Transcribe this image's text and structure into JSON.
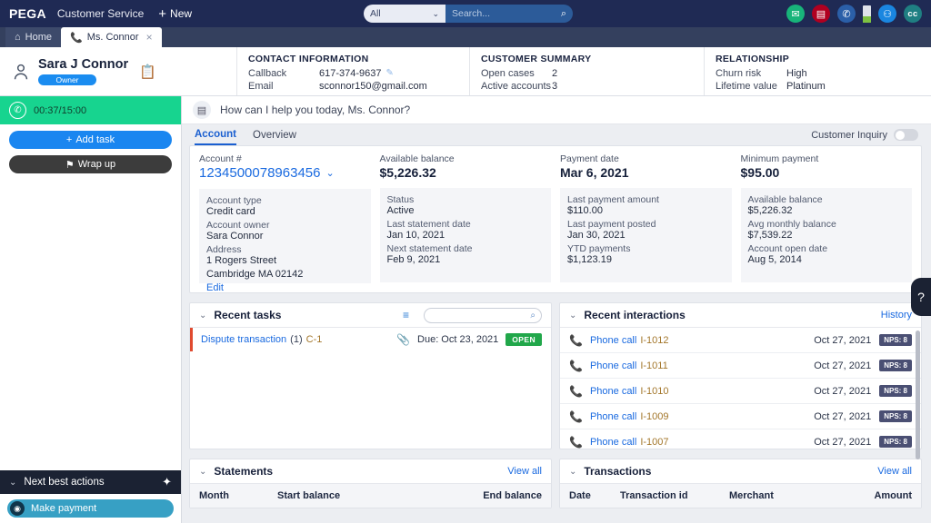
{
  "topbar": {
    "brand": "PEGA",
    "app_name": "Customer Service",
    "new_label": "New",
    "search": {
      "scope": "All",
      "placeholder": "Search...",
      "value": ""
    },
    "icons": [
      "envelope-icon",
      "chat-icon",
      "phone-icon",
      "status-bar-icon",
      "bot-icon",
      "avatar-cc"
    ],
    "avatar_initials": "cc"
  },
  "tabs": [
    {
      "label": "Home",
      "icon": "home-icon",
      "active": false
    },
    {
      "label": "Ms. Connor",
      "icon": "phone-icon",
      "active": true,
      "closable": true
    }
  ],
  "customer_header": {
    "name": "Sara J Connor",
    "role_badge": "Owner",
    "contact": {
      "title": "CONTACT INFORMATION",
      "rows": [
        {
          "key": "Callback",
          "value": "617-374-9637",
          "editable": true
        },
        {
          "key": "Email",
          "value": "sconnor150@gmail.com",
          "editable": false
        }
      ]
    },
    "summary": {
      "title": "CUSTOMER SUMMARY",
      "rows": [
        {
          "key": "Open cases",
          "value": "2"
        },
        {
          "key": "Active accounts",
          "value": "3"
        }
      ]
    },
    "relationship": {
      "title": "RELATIONSHIP",
      "rows": [
        {
          "key": "Churn risk",
          "value": "High"
        },
        {
          "key": "Lifetime value",
          "value": "Platinum"
        }
      ]
    }
  },
  "rail": {
    "timer": "00:37/15:00",
    "add_task": "Add task",
    "wrap_up": "Wrap up",
    "nba_title": "Next best actions",
    "nba_items": [
      {
        "label": "Make payment"
      }
    ]
  },
  "main": {
    "prompt": "How can I help you today, Ms. Connor?",
    "tabs": [
      {
        "label": "Account",
        "active": true
      },
      {
        "label": "Overview",
        "active": false
      }
    ],
    "inquiry_label": "Customer Inquiry",
    "inquiry_on": false
  },
  "account": {
    "columns": [
      {
        "label": "Account #",
        "value": "1234500078963456",
        "is_link": true,
        "details": [
          {
            "k": "Account type",
            "v": "Credit card"
          },
          {
            "k": "Account owner",
            "v": "Sara Connor"
          },
          {
            "k": "Address",
            "v": "1 Rogers Street"
          },
          {
            "k": "",
            "v": "Cambridge  MA 02142"
          }
        ],
        "edit_link": "Edit"
      },
      {
        "label": "Available balance",
        "value": "$5,226.32",
        "is_link": false,
        "details": [
          {
            "k": "Status",
            "v": "Active"
          },
          {
            "k": "Last statement date",
            "v": "Jan 10, 2021"
          },
          {
            "k": "Next statement date",
            "v": "Feb 9, 2021"
          }
        ]
      },
      {
        "label": "Payment date",
        "value": "Mar 6, 2021",
        "is_link": false,
        "details": [
          {
            "k": "Last payment amount",
            "v": "$110.00"
          },
          {
            "k": "Last payment posted",
            "v": "Jan 30, 2021"
          },
          {
            "k": "YTD payments",
            "v": "$1,123.19"
          }
        ]
      },
      {
        "label": "Minimum payment",
        "value": "$95.00",
        "is_link": false,
        "details": [
          {
            "k": "Available balance",
            "v": "$5,226.32"
          },
          {
            "k": "Avg monthly balance",
            "v": "$7,539.22"
          },
          {
            "k": "Account open date",
            "v": "Aug 5, 2014"
          }
        ]
      }
    ]
  },
  "recent_tasks": {
    "title": "Recent tasks",
    "search_placeholder": "",
    "rows": [
      {
        "name": "Dispute transaction",
        "count": "(1)",
        "id": "C-1",
        "due": "Due: Oct 23, 2021",
        "status": "OPEN"
      }
    ]
  },
  "recent_interactions": {
    "title": "Recent interactions",
    "history_link": "History",
    "rows": [
      {
        "type": "Phone call",
        "id": "I-1012",
        "date": "Oct 27, 2021",
        "nps": "NPS: 8"
      },
      {
        "type": "Phone call",
        "id": "I-1011",
        "date": "Oct 27, 2021",
        "nps": "NPS: 8"
      },
      {
        "type": "Phone call",
        "id": "I-1010",
        "date": "Oct 27, 2021",
        "nps": "NPS: 8"
      },
      {
        "type": "Phone call",
        "id": "I-1009",
        "date": "Oct 27, 2021",
        "nps": "NPS: 8"
      },
      {
        "type": "Phone call",
        "id": "I-1007",
        "date": "Oct 27, 2021",
        "nps": "NPS: 8"
      }
    ]
  },
  "statements": {
    "title": "Statements",
    "view_all": "View all",
    "headers": [
      "Month",
      "Start balance",
      "End balance"
    ]
  },
  "transactions": {
    "title": "Transactions",
    "view_all": "View all",
    "headers": [
      "Date",
      "Transaction id",
      "Merchant",
      "Amount"
    ]
  },
  "help_button": "?"
}
